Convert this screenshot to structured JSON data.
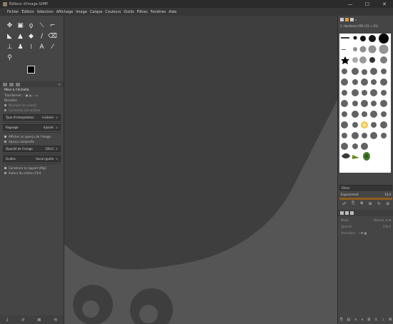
{
  "window": {
    "title": "Éditeur d'image GIMP"
  },
  "window_controls": {
    "minimize": "—",
    "maximize": "☐",
    "close": "✕"
  },
  "menu": [
    "Fichier",
    "Édition",
    "Sélection",
    "Affichage",
    "Image",
    "Calque",
    "Couleurs",
    "Outils",
    "Filtres",
    "Fenêtres",
    "Aide"
  ],
  "tool_options": {
    "title": "Mise à l'échelle",
    "transform_label": "Transformer :",
    "direction_label": "Direction",
    "direction_normal": "Normale (en avant)",
    "direction_corrective": "Corrective (en arrière)",
    "interpolation_label": "Type d'interpolation",
    "interpolation_value": "Linéaire",
    "clipping_label": "Rognage",
    "clipping_value": "Ajuster",
    "show_preview": "Afficher un aperçu de l'image",
    "composite_preview": "Aperçu composite",
    "opacity_label": "Opacité de l'image",
    "opacity_value": "100,0",
    "guides_label": "Guides",
    "guides_value": "Aucun guide",
    "keep_aspect": "Conserver le rapport (Maj)",
    "around_center": "Autour du centre (Ctrl)"
  },
  "dock": {
    "brushes_title": "2. Hardness 050 (51 × 51)",
    "filter_label": "Filtrer",
    "spacing_label": "Espacement",
    "spacing_value": "10,0",
    "mode_label": "Mode",
    "mode_value": "Normal",
    "opacity_label": "Opacité",
    "opacity_value": "100,0",
    "lock_label": "Verrouiller :"
  },
  "colors": {
    "foreground": "#000000",
    "background": "#ffffff",
    "accent": "#8f5d1a"
  }
}
